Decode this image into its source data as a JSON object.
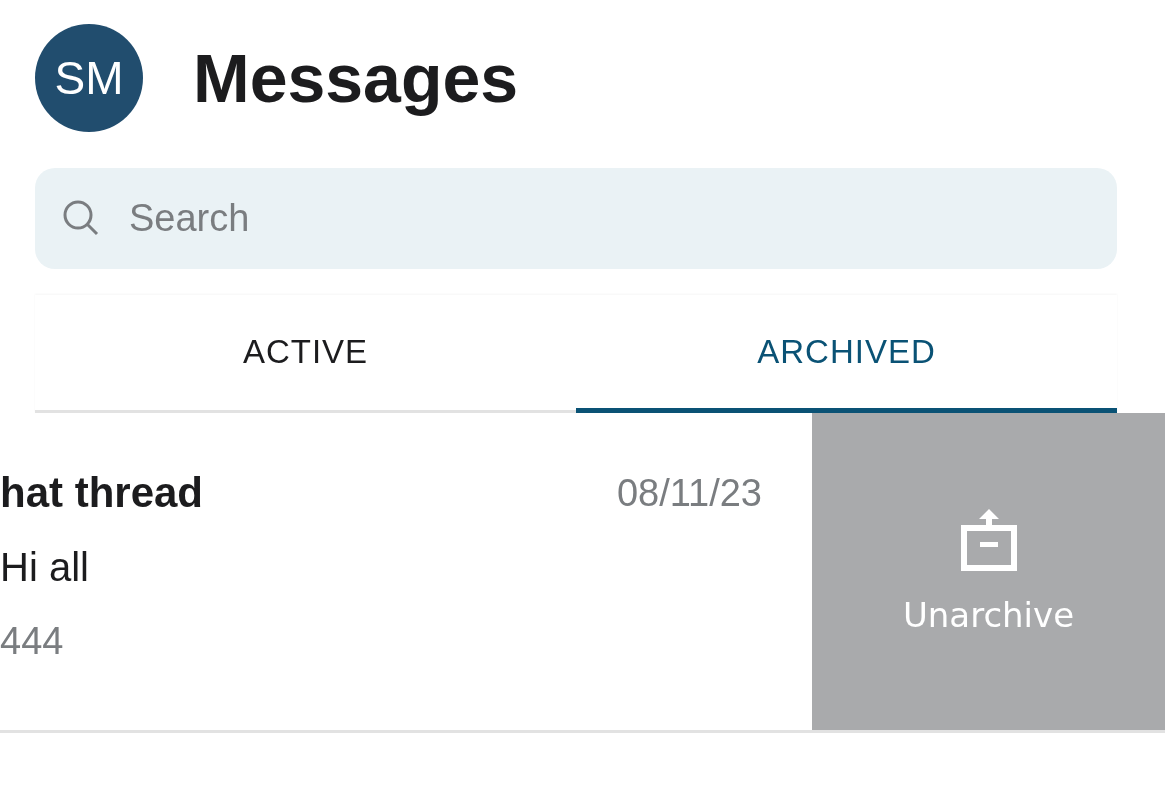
{
  "header": {
    "avatar": "SM",
    "title": "Messages"
  },
  "search": {
    "placeholder": "Search"
  },
  "tabs": [
    {
      "label": "ACTIVE",
      "selected": false
    },
    {
      "label": "ARCHIVED",
      "selected": true
    }
  ],
  "conversations": [
    {
      "title": "hat thread",
      "date": "08/11/23",
      "preview": "Hi all",
      "meta": "444",
      "action": "Unarchive"
    }
  ]
}
